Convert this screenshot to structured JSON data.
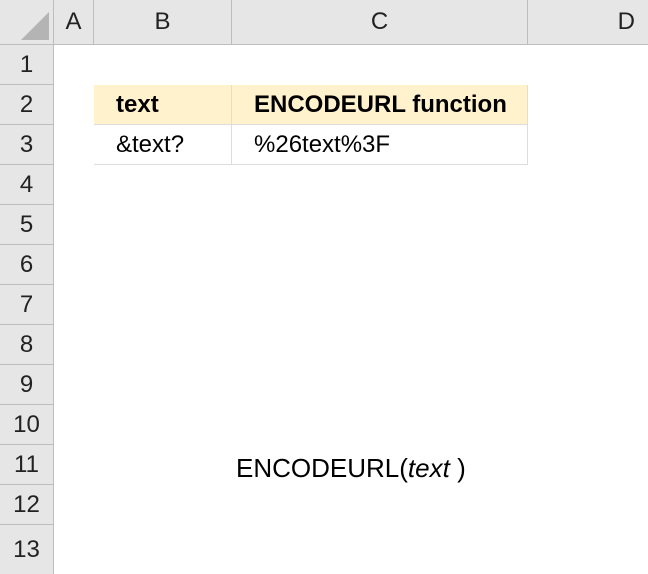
{
  "columns": [
    "A",
    "B",
    "C",
    "D"
  ],
  "rows": [
    "1",
    "2",
    "3",
    "4",
    "5",
    "6",
    "7",
    "8",
    "9",
    "10",
    "11",
    "12",
    "13"
  ],
  "table": {
    "headers": [
      "text",
      "ENCODEURL function"
    ],
    "rows": [
      [
        "&text?",
        "%26text%3F"
      ]
    ]
  },
  "syntax": {
    "func": "ENCODEURL(",
    "arg": "text",
    "close": " )"
  },
  "colors": {
    "header_fill": "#fff2cc",
    "grid_header_fill": "#e6e6e6"
  }
}
